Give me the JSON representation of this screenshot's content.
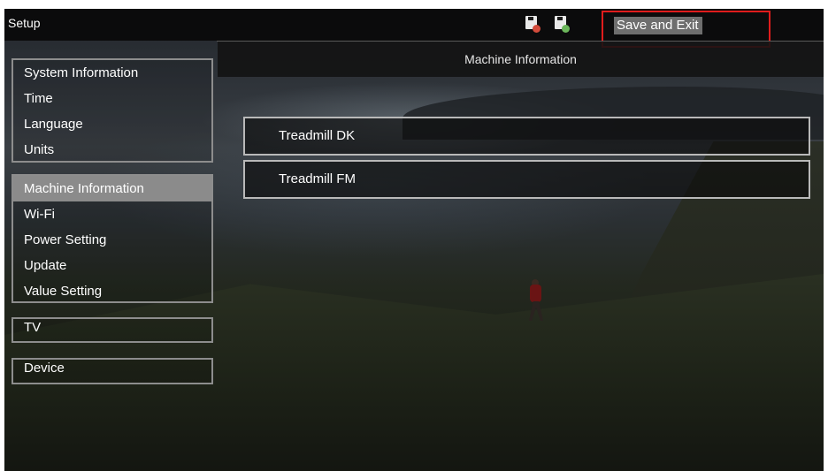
{
  "topbar": {
    "title": "Setup",
    "icons": [
      {
        "name": "sd-card-error-icon",
        "status_color": "#d34b3b"
      },
      {
        "name": "usb-connected-icon",
        "status_color": "#6bb65b"
      }
    ],
    "save_exit_label": "Save and Exit",
    "highlight_color": "#e01c1c"
  },
  "header": {
    "title": "Machine Information"
  },
  "sidebar": {
    "groups": [
      {
        "items": [
          {
            "label": "System Information",
            "selected": false
          },
          {
            "label": "Time",
            "selected": false
          },
          {
            "label": "Language",
            "selected": false
          },
          {
            "label": "Units",
            "selected": false
          }
        ]
      },
      {
        "items": [
          {
            "label": "Machine Information",
            "selected": true
          },
          {
            "label": "Wi-Fi",
            "selected": false
          },
          {
            "label": "Power Setting",
            "selected": false
          },
          {
            "label": "Update",
            "selected": false
          },
          {
            "label": "Value Setting",
            "selected": false
          }
        ]
      },
      {
        "items": [
          {
            "label": "TV",
            "selected": false
          }
        ]
      },
      {
        "items": [
          {
            "label": "Device",
            "selected": false
          }
        ]
      }
    ]
  },
  "content": {
    "items": [
      {
        "label": "Treadmill DK"
      },
      {
        "label": "Treadmill FM"
      }
    ]
  },
  "colors": {
    "selected_item_bg": "#8b8b8b",
    "topbar_bg": "#0b0b0c"
  }
}
